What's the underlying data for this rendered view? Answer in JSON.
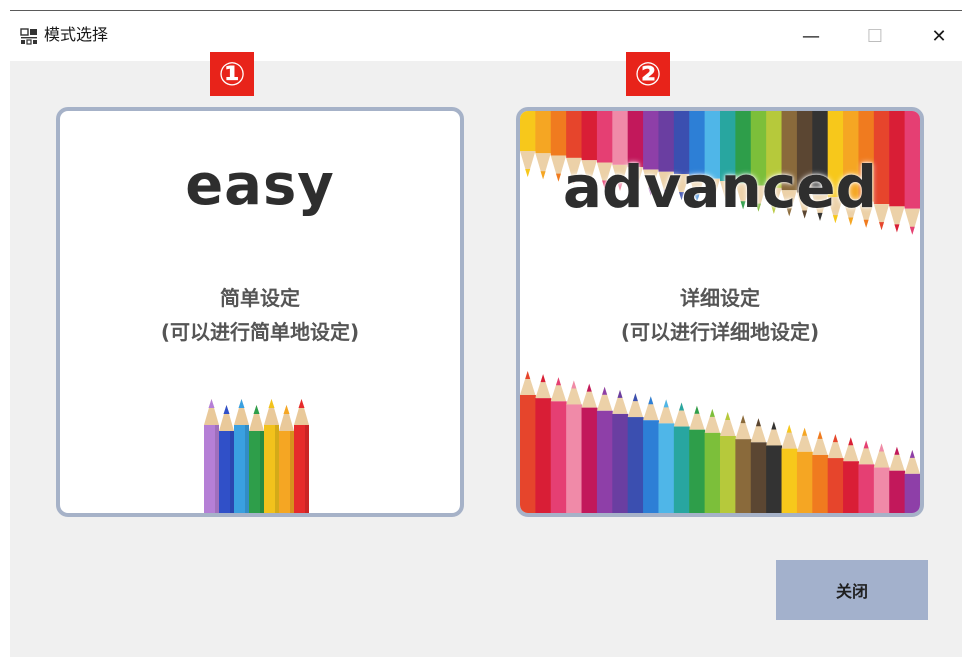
{
  "window": {
    "title": "模式选择",
    "app_icon": "app-logo-icon",
    "controls": {
      "minimize": "—",
      "maximize": "☐",
      "close": "✕"
    }
  },
  "badges": [
    "①",
    "②"
  ],
  "cards": {
    "easy": {
      "heading": "easy",
      "line1": "简单设定",
      "line2": "(可以进行简单地设定)"
    },
    "advanced": {
      "heading": "advanced",
      "line1": "详细设定",
      "line2": "(可以进行详细地设定)"
    }
  },
  "footer": {
    "close_label": "关闭"
  },
  "colors": {
    "badge": "#e8231a",
    "card_border": "#a6b2c8",
    "close_button": "#a3b1cc",
    "window_bg": "#f0f0f0"
  }
}
